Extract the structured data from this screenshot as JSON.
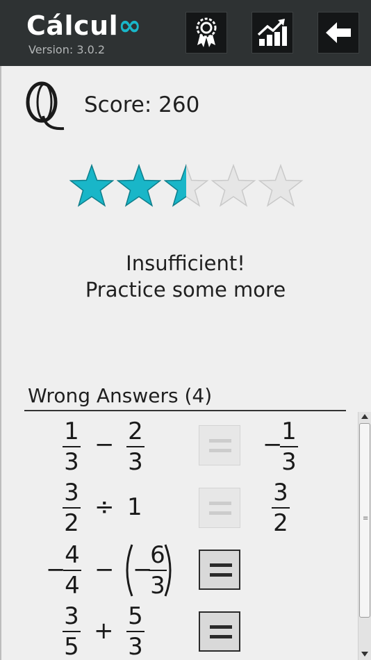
{
  "app": {
    "title_text": "Cálcul",
    "title_symbol": "∞",
    "version": "Version: 3.0.2"
  },
  "header": {
    "buttons": [
      {
        "name": "achievements",
        "icon": "award-ribbon-icon"
      },
      {
        "name": "statistics",
        "icon": "chart-growth-icon"
      },
      {
        "name": "back",
        "icon": "back-arrow-icon"
      }
    ]
  },
  "colors": {
    "accent": "#19b6c8",
    "header_bg": "#2e3233",
    "star_empty": "#e6e6e6"
  },
  "result": {
    "score_label": "Score: 260",
    "rating_stars": 2.5,
    "max_stars": 5,
    "verdict_line1": "Insufficient!",
    "verdict_line2": "Practice some more"
  },
  "wrong_answers": {
    "title": "Wrong Answers (4)",
    "items": [
      {
        "left": {
          "num": "1",
          "den": "3"
        },
        "op": "−",
        "right": {
          "num": "2",
          "den": "3"
        },
        "answer": {
          "sign": "−",
          "num": "1",
          "den": "3"
        }
      },
      {
        "left": {
          "num": "3",
          "den": "2"
        },
        "op": "÷",
        "right": "1",
        "answer": {
          "num": "3",
          "den": "2"
        }
      },
      {
        "left": {
          "sign": "−",
          "num": "4",
          "den": "4"
        },
        "op": "−",
        "right": {
          "sign": "−",
          "num": "6",
          "den": "3"
        }
      },
      {
        "left": {
          "num": "3",
          "den": "5"
        },
        "op": "+",
        "right": {
          "num": "5",
          "den": "3"
        }
      }
    ]
  }
}
